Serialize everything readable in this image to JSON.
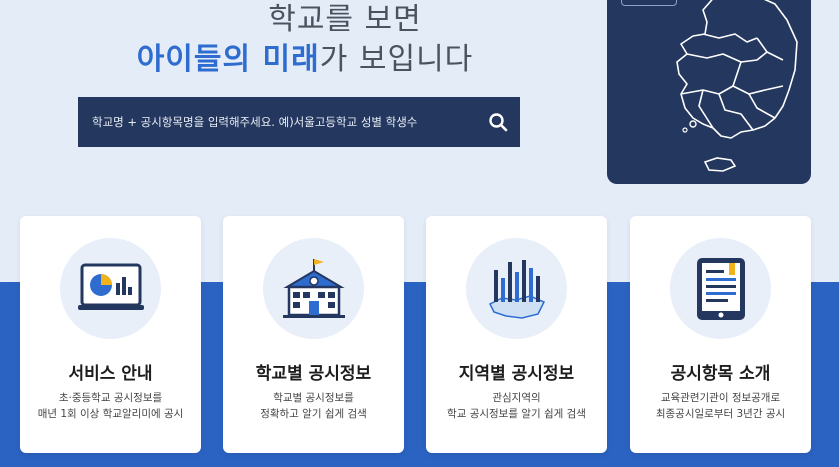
{
  "hero": {
    "line1": "학교를 보면",
    "line2_accent": "아이들의 미래",
    "line2_rest": "가 보입니다"
  },
  "search": {
    "placeholder": "학교명 + 공시항목명을 입력해주세요. 예)서울고등학교 성별 학생수",
    "icon": "search-icon"
  },
  "map": {
    "icon": "korea-map-icon"
  },
  "cards": [
    {
      "title": "서비스 안내",
      "desc1": "초·중등학교 공시정보를",
      "desc2": "매년 1회 이상 학교알리미에 공시",
      "icon": "chart-monitor-icon"
    },
    {
      "title": "학교별 공시정보",
      "desc1": "학교별 공시정보를",
      "desc2": "정확하고 알기 쉽게 검색",
      "icon": "school-building-icon"
    },
    {
      "title": "지역별 공시정보",
      "desc1": "관심지역의",
      "desc2": "학교 공시정보를 알기 쉽게 검색",
      "icon": "regional-bar-chart-icon"
    },
    {
      "title": "공시항목 소개",
      "desc1": "교육관련기관이 정보공개로",
      "desc2": "최종공시일로부터 3년간 공시",
      "icon": "tablet-document-icon"
    }
  ],
  "colors": {
    "accent": "#2e6cd0",
    "navy": "#24375f",
    "band": "#2b63c2",
    "light_bg": "#e4ecf8"
  }
}
